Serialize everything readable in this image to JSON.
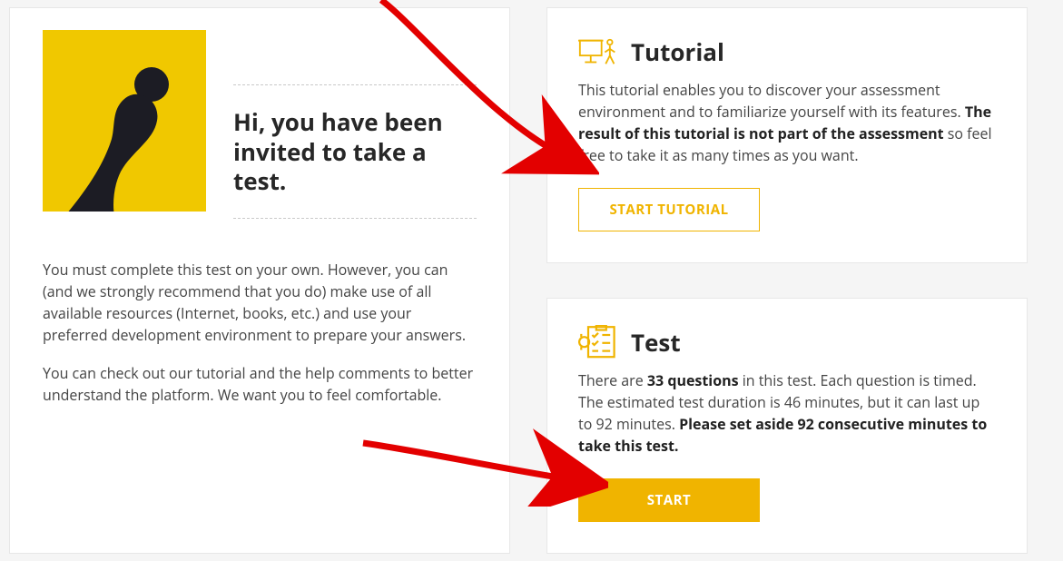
{
  "greeting": "Hi, you have been invited to take a test.",
  "intro_p1": "You must complete this test on your own. However, you can (and we strongly recommend that you do) make use of all available resources (Internet, books, etc.) and use your preferred development environment to prepare your answers.",
  "intro_p2": "You can check out our tutorial and the help comments to better understand the platform. We want you to feel comfortable.",
  "tutorial": {
    "title": "Tutorial",
    "body_pre": "This tutorial enables you to discover your assessment environment and to familiarize yourself with its features. ",
    "body_bold": "The result of this tutorial is not part of the assessment",
    "body_post": " so feel free to take it as many times as you want.",
    "button": "Start Tutorial"
  },
  "test": {
    "title": "Test",
    "p1_a": "There are ",
    "p1_b_bold": "33 questions",
    "p1_c": " in this test. Each question is timed. The estimated test duration is 46 minutes, but it can last up to 92 minutes. ",
    "p1_d_bold": "Please set aside 92 consecutive minutes to take this test.",
    "button": "Start"
  }
}
